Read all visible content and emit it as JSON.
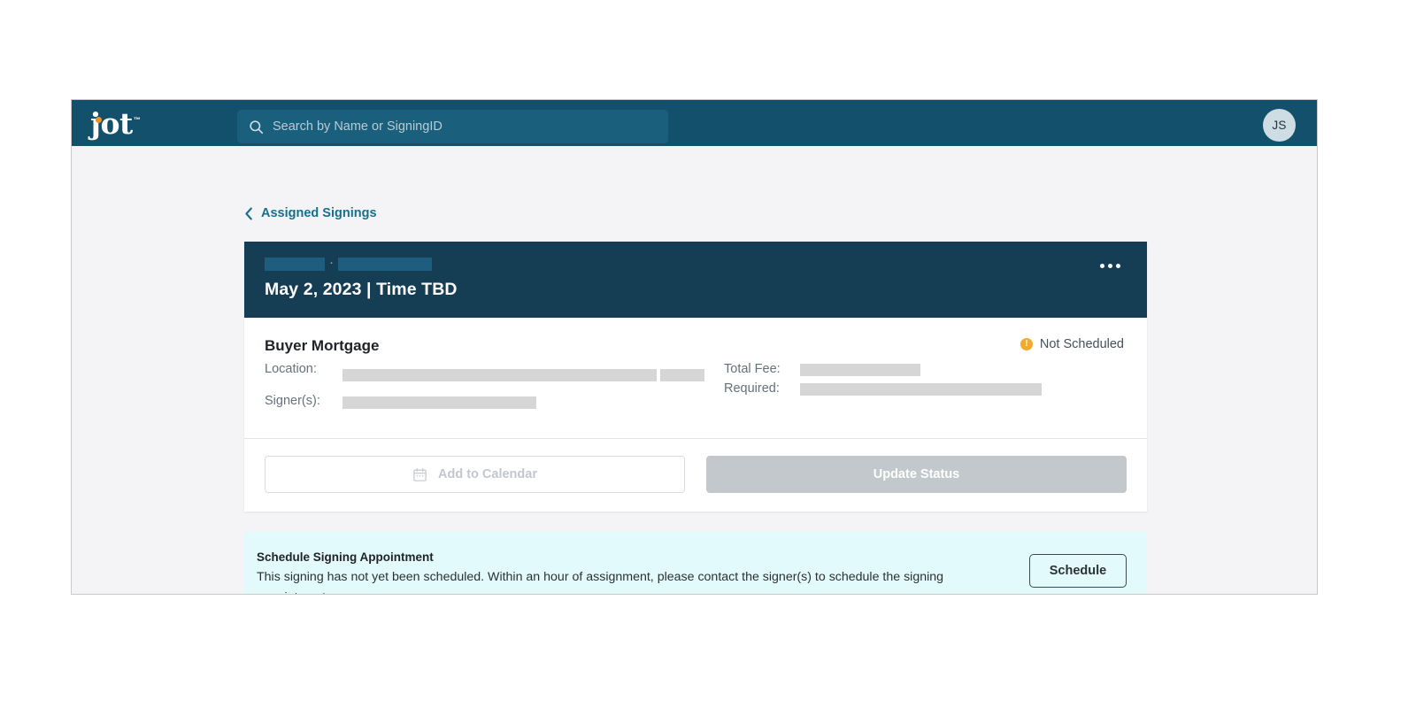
{
  "topbar": {
    "logo_text": "jot",
    "logo_tm": "™",
    "search_placeholder": "Search by Name or SigningID",
    "search_value": "",
    "avatar_initials": "JS"
  },
  "breadcrumb": {
    "label": "Assigned Signings",
    "chevron": "back-chevron-icon"
  },
  "card": {
    "header": {
      "redaction_separator": "·",
      "date_line": "May 2, 2023 | Time TBD",
      "menu_icon": "kebab-menu-icon"
    },
    "body": {
      "title": "Buyer Mortgage",
      "status": {
        "icon_glyph": "!",
        "label": "Not Scheduled",
        "color": "#f0ab2f"
      },
      "fields_left": [
        {
          "label": "Location:"
        },
        {
          "label": "Signer(s):"
        }
      ],
      "fields_right": [
        {
          "label": "Total Fee:"
        },
        {
          "label": "Required:"
        }
      ]
    },
    "footer": {
      "add_to_calendar_label": "Add to Calendar",
      "add_to_calendar_icon": "calendar-icon",
      "update_status_label": "Update Status"
    }
  },
  "notice": {
    "title": "Schedule Signing Appointment",
    "body": "This signing has not yet been scheduled. Within an hour of assignment, please contact the signer(s) to schedule the signing appointment.",
    "button_label": "Schedule"
  },
  "colors": {
    "topbar_bg": "#13506b",
    "card_header_bg": "#153e55",
    "accent_link": "#15708f",
    "status_amber": "#f0ab2f",
    "notice_bg": "#e3fafc",
    "redaction_gray": "#d6d6d6",
    "redaction_header": "#1d5e7e"
  }
}
